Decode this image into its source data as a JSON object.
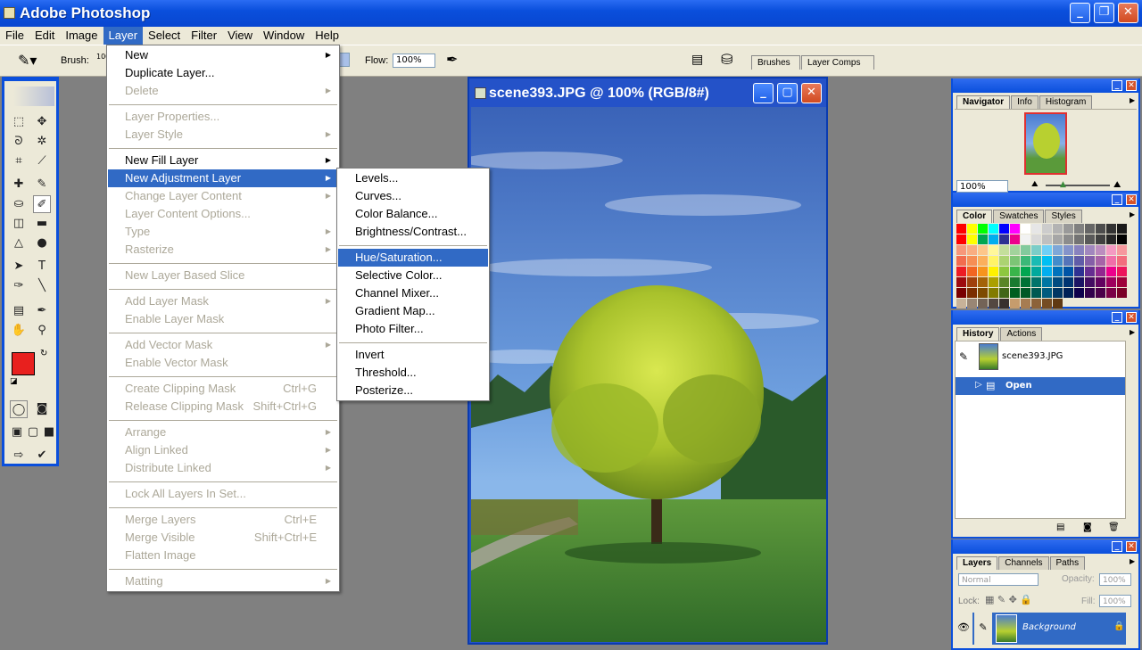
{
  "app": {
    "title": "Adobe Photoshop"
  },
  "menubar": [
    "File",
    "Edit",
    "Image",
    "Layer",
    "Select",
    "Filter",
    "View",
    "Window",
    "Help"
  ],
  "options": {
    "brush_label": "Brush:",
    "brush_size": "100",
    "flow_label": "Flow:",
    "flow_value": "100%"
  },
  "palette_well_tabs": [
    "Brushes",
    "Layer Comps"
  ],
  "layer_menu": [
    {
      "label": "New",
      "arrow": true,
      "dis": false
    },
    {
      "label": "Duplicate Layer...",
      "dis": false
    },
    {
      "label": "Delete",
      "arrow": true,
      "dis": true
    },
    {
      "sep": true
    },
    {
      "label": "Layer Properties...",
      "dis": true
    },
    {
      "label": "Layer Style",
      "arrow": true,
      "dis": true
    },
    {
      "sep": true
    },
    {
      "label": "New Fill Layer",
      "arrow": true,
      "dis": false
    },
    {
      "label": "New Adjustment Layer",
      "arrow": true,
      "dis": false,
      "hl": true
    },
    {
      "label": "Change Layer Content",
      "arrow": true,
      "dis": true
    },
    {
      "label": "Layer Content Options...",
      "dis": true
    },
    {
      "label": "Type",
      "arrow": true,
      "dis": true
    },
    {
      "label": "Rasterize",
      "arrow": true,
      "dis": true
    },
    {
      "sep": true
    },
    {
      "label": "New Layer Based Slice",
      "dis": true
    },
    {
      "sep": true
    },
    {
      "label": "Add Layer Mask",
      "arrow": true,
      "dis": true
    },
    {
      "label": "Enable Layer Mask",
      "dis": true
    },
    {
      "sep": true
    },
    {
      "label": "Add Vector Mask",
      "arrow": true,
      "dis": true
    },
    {
      "label": "Enable Vector Mask",
      "dis": true
    },
    {
      "sep": true
    },
    {
      "label": "Create Clipping Mask",
      "shortcut": "Ctrl+G",
      "dis": true
    },
    {
      "label": "Release Clipping Mask",
      "shortcut": "Shift+Ctrl+G",
      "dis": true
    },
    {
      "sep": true
    },
    {
      "label": "Arrange",
      "arrow": true,
      "dis": true
    },
    {
      "label": "Align Linked",
      "arrow": true,
      "dis": true
    },
    {
      "label": "Distribute Linked",
      "arrow": true,
      "dis": true
    },
    {
      "sep": true
    },
    {
      "label": "Lock All Layers In Set...",
      "dis": true
    },
    {
      "sep": true
    },
    {
      "label": "Merge Layers",
      "shortcut": "Ctrl+E",
      "dis": true
    },
    {
      "label": "Merge Visible",
      "shortcut": "Shift+Ctrl+E",
      "dis": true
    },
    {
      "label": "Flatten Image",
      "dis": true
    },
    {
      "sep": true
    },
    {
      "label": "Matting",
      "arrow": true,
      "dis": true
    }
  ],
  "adjust_menu": [
    {
      "label": "Levels..."
    },
    {
      "label": "Curves..."
    },
    {
      "label": "Color Balance..."
    },
    {
      "label": "Brightness/Contrast..."
    },
    {
      "sep": true
    },
    {
      "label": "Hue/Saturation...",
      "hl": true
    },
    {
      "label": "Selective Color..."
    },
    {
      "label": "Channel Mixer..."
    },
    {
      "label": "Gradient Map..."
    },
    {
      "label": "Photo Filter..."
    },
    {
      "sep": true
    },
    {
      "label": "Invert"
    },
    {
      "label": "Threshold..."
    },
    {
      "label": "Posterize..."
    }
  ],
  "document": {
    "title": "scene393.JPG @  100% (RGB/8#)"
  },
  "navigator": {
    "tabs": [
      "Navigator",
      "Info",
      "Histogram"
    ],
    "zoom": "100%"
  },
  "color_palette": {
    "tabs": [
      "Color",
      "Swatches",
      "Styles"
    ]
  },
  "history": {
    "tabs": [
      "History",
      "Actions"
    ],
    "snapshot": "scene393.JPG",
    "step": "Open"
  },
  "layers": {
    "tabs": [
      "Layers",
      "Channels",
      "Paths"
    ],
    "blend": "Normal",
    "opacity_label": "Opacity:",
    "opacity": "100%",
    "lock_label": "Lock:",
    "fill_label": "Fill:",
    "fill": "100%",
    "layer_name": "Background"
  },
  "colors": {
    "accent": "#316ac5",
    "foreground": "#e8201e",
    "background": "#ffffff"
  }
}
